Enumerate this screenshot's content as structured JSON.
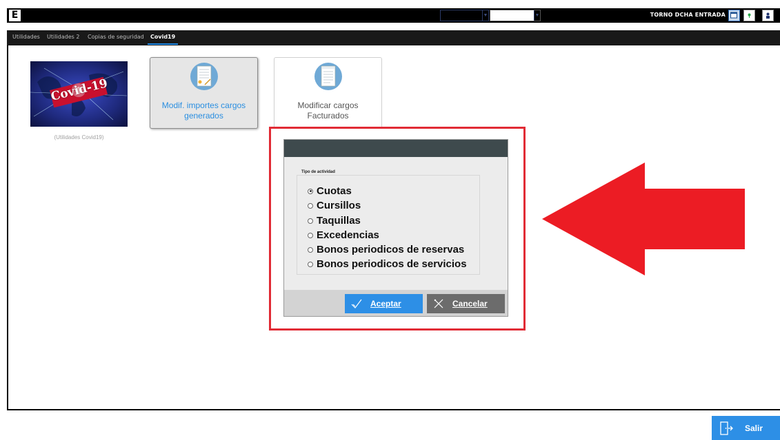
{
  "app": {
    "logo_letter": "E",
    "station": "TORNO DCHA ENTRADA"
  },
  "tabs": [
    {
      "label": "Utilidades",
      "active": false
    },
    {
      "label": "Utilidades 2",
      "active": false
    },
    {
      "label": "Copias de seguridad",
      "active": false
    },
    {
      "label": "Covid19",
      "active": true
    }
  ],
  "tiles": {
    "covid_image": {
      "text": "Covid-19",
      "caption": "(Utilidades Covid19)"
    },
    "modif_importes": {
      "label": "Modif. importes cargos generados",
      "icon": "certificate-document-icon"
    },
    "modificar_facturados": {
      "label": "Modificar cargos Facturados",
      "icon": "invoice-document-icon"
    }
  },
  "dialog": {
    "group_label": "Tipo de actividad",
    "options": [
      {
        "label": "Cuotas",
        "checked": true
      },
      {
        "label": "Cursillos",
        "checked": false
      },
      {
        "label": "Taquillas",
        "checked": false
      },
      {
        "label": "Excedencias",
        "checked": false
      },
      {
        "label": "Bonos periodicos de reservas",
        "checked": false
      },
      {
        "label": "Bonos periodicos de servicios",
        "checked": false
      }
    ],
    "accept_label": "Aceptar",
    "cancel_label": "Cancelar"
  },
  "footer": {
    "exit_label": "Salir"
  },
  "colors": {
    "accent": "#2d8fe6",
    "highlight": "#e12b35",
    "dialog_header": "#3e4a4d"
  }
}
